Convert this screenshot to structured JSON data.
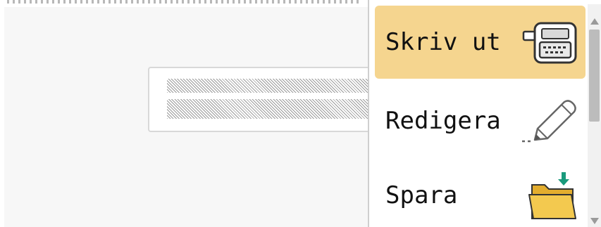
{
  "menu": {
    "items": [
      {
        "label": "Skriv ut",
        "icon": "printer-icon",
        "active": true
      },
      {
        "label": "Redigera",
        "icon": "pencil-icon",
        "active": false
      },
      {
        "label": "Spara",
        "icon": "folder-download-icon",
        "active": false
      }
    ]
  },
  "colors": {
    "active_highlight": "#f5d58f",
    "background": "#f7f7f7",
    "folder": "#f3c94f",
    "download_arrow": "#1a9a7c"
  }
}
